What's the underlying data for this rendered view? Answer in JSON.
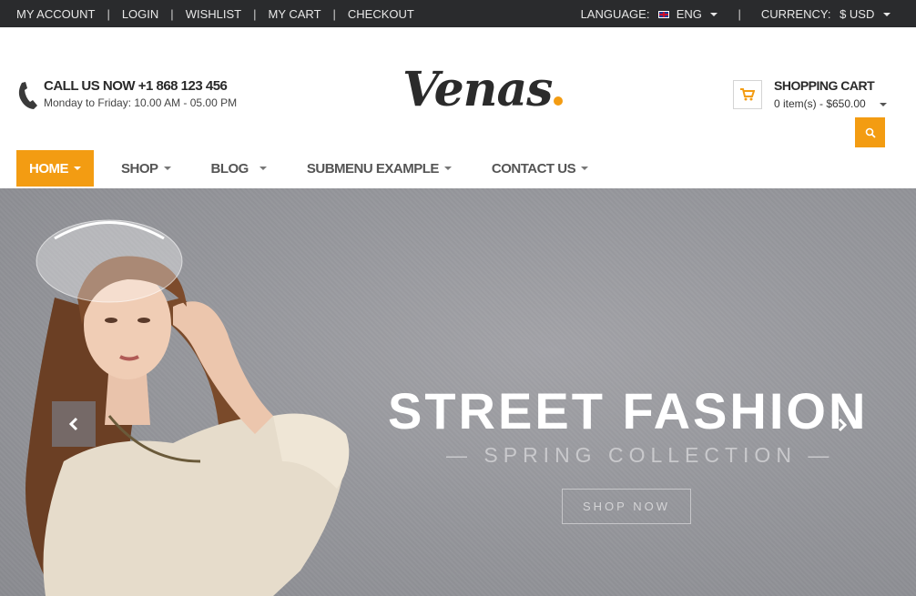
{
  "topbar": {
    "links": [
      "MY ACCOUNT",
      "LOGIN",
      "WISHLIST",
      "MY CART",
      "CHECKOUT"
    ],
    "language_label": "LANGUAGE:",
    "language_value": "ENG",
    "currency_label": "CURRENCY:",
    "currency_value": "$ USD"
  },
  "header": {
    "call_title": "CALL US NOW  +1  868 123 456",
    "call_hours": "Monday to Friday: 10.00 AM - 05.00 PM",
    "logo_text": "Venas",
    "cart_title": "SHOPPING CART",
    "cart_summary": "0 item(s)  -  $650.00"
  },
  "nav": {
    "items": [
      "HOME",
      "SHOP",
      "BLOG",
      "SUBMENU EXAMPLE",
      "CONTACT US"
    ]
  },
  "hero": {
    "headline": "STREET FASHION",
    "subline": "— SPRING COLLECTION —",
    "button": "SHOP NOW"
  },
  "colors": {
    "accent": "#f39c12",
    "topbar_bg": "#2a2b2d"
  },
  "icons": [
    "phone-icon",
    "cart-icon",
    "search-icon",
    "chevron-left-icon",
    "chevron-right-icon",
    "uk-flag-icon"
  ]
}
